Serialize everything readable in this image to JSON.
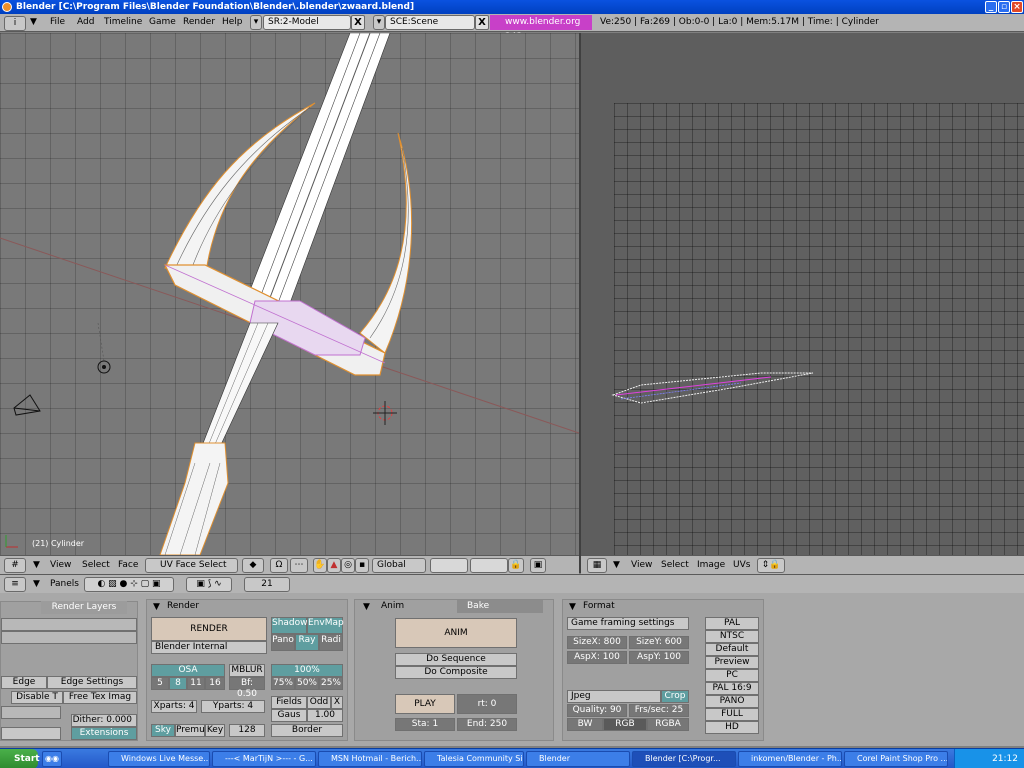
{
  "window": {
    "title": "Blender [C:\\Program Files\\Blender Foundation\\Blender\\.blender\\zwaard.blend]"
  },
  "menu": {
    "items": [
      "File",
      "Add",
      "Timeline",
      "Game",
      "Render",
      "Help"
    ],
    "screen_field": "SR:2-Model",
    "scene_field": "SCE:Scene",
    "url": "www.blender.org 243",
    "stats": "Ve:250 | Fa:269 | Ob:0-0 | La:0  | Mem:5.17M  | Time: | Cylinder",
    "close_glyph": "X"
  },
  "view3d": {
    "object_label": "(21) Cylinder"
  },
  "view3d_header": {
    "view": "View",
    "select": "Select",
    "face": "Face",
    "mode": "UV Face Select",
    "orientation": "Global"
  },
  "uv_header": {
    "view": "View",
    "select": "Select",
    "image": "Image",
    "uvs": "UVs"
  },
  "buttons_header": {
    "panels": "Panels",
    "frame": "21"
  },
  "panels": {
    "render_layers": {
      "tab": "Render Layers",
      "edge": "Edge",
      "edge_settings": "Edge Settings",
      "disable_t": "Disable T",
      "free_tex": "Free Tex Imag",
      "dither": "Dither: 0.000",
      "extensions": "Extensions"
    },
    "render": {
      "tab": "Render",
      "render_btn": "RENDER",
      "engine": "Blender Internal",
      "shadow": "Shadow",
      "envmap": "EnvMap",
      "pano": "Pano",
      "ray": "Ray",
      "radi": "Radi",
      "osa": "OSA",
      "osa_vals": [
        "5",
        "8",
        "11",
        "16"
      ],
      "mblur": "MBLUR",
      "bf": "Bf: 0.50",
      "pct": "100%",
      "pct_vals": [
        "75%",
        "50%",
        "25%"
      ],
      "xparts": "Xparts: 4",
      "yparts": "Yparts: 4",
      "fields": "Fields",
      "odd": "Odd",
      "x": "X",
      "gaus": "Gaus",
      "gaus_val": "1.00",
      "sky": "Sky",
      "premul": "Premul",
      "key": "Key",
      "size128": "128",
      "border": "Border"
    },
    "anim": {
      "tab": "Anim",
      "bake": "Bake",
      "anim_btn": "ANIM",
      "do_sequence": "Do Sequence",
      "do_composite": "Do Composite",
      "play": "PLAY",
      "rt": "rt: 0",
      "sta": "Sta: 1",
      "end": "End: 250"
    },
    "format": {
      "tab": "Format",
      "game_framing": "Game framing settings",
      "sizex": "SizeX: 800",
      "sizey": "SizeY: 600",
      "aspx": "AspX: 100",
      "aspy": "AspY: 100",
      "presets": [
        "PAL",
        "NTSC",
        "Default",
        "Preview",
        "PC",
        "PAL 16:9",
        "PANO",
        "FULL",
        "HD"
      ],
      "jpeg": "Jpeg",
      "crop": "Crop",
      "quality": "Quality: 90",
      "fps": "Frs/sec: 25",
      "bw": "BW",
      "rgb": "RGB",
      "rgba": "RGBA"
    }
  },
  "taskbar": {
    "start": "Start",
    "tasks": [
      "Windows Live Messe...",
      "---< MarTijN >--- - G...",
      "MSN Hotmail - Berich...",
      "Talesia Community Si...",
      "Blender",
      "Blender [C:\\Progr...",
      "inkomen/Blender - Ph...",
      "Corel Paint Shop Pro ..."
    ],
    "clock": "21:12"
  },
  "colors": {
    "titlebar": "#0a52e0",
    "wire_select": "#f0a030",
    "taskbar": "#2458c8"
  }
}
